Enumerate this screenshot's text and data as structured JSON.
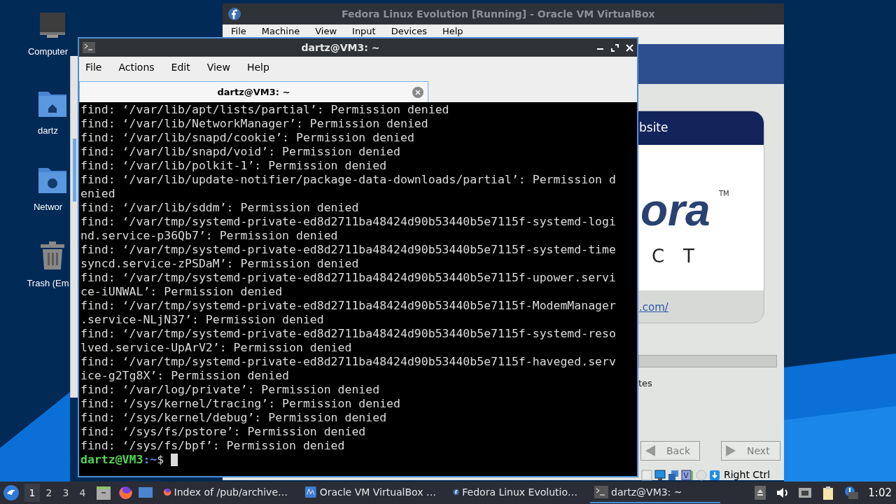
{
  "desktop_icons": [
    {
      "label": "Computer",
      "kind": "computer"
    },
    {
      "label": "dartz",
      "kind": "home"
    },
    {
      "label": "Networ",
      "kind": "network"
    },
    {
      "label": "Trash (Em",
      "kind": "trash"
    }
  ],
  "vbox_window": {
    "title": "Fedora Linux Evolution [Running] - Oracle VM VirtualBox",
    "menu": [
      "File",
      "Machine",
      "View",
      "Input",
      "Devices",
      "Help"
    ],
    "guest": {
      "card_heading": "bsite",
      "logo_text": "ora",
      "trademark": "TM",
      "logo_letters": [
        "C",
        "T"
      ],
      "link": ".com/",
      "progress": {
        "level": 1
      },
      "note": "tes",
      "buttons": [
        {
          "label": "Back",
          "kind": "back",
          "disabled": true
        },
        {
          "label": "Next",
          "kind": "next",
          "disabled": true
        }
      ]
    },
    "host_key": "Right Ctrl"
  },
  "terminal": {
    "title": "dartz@VM3: ~",
    "menu": [
      "File",
      "Actions",
      "Edit",
      "View",
      "Help"
    ],
    "tabs": [
      {
        "label": "dartz@VM3: ~",
        "selected": true
      }
    ],
    "lines": [
      "find: ‘/var/lib/apt/lists/partial’: Permission denied",
      "find: ‘/var/lib/NetworkManager’: Permission denied",
      "find: ‘/var/lib/snapd/cookie’: Permission denied",
      "find: ‘/var/lib/snapd/void’: Permission denied",
      "find: ‘/var/lib/polkit-1’: Permission denied",
      "find: ‘/var/lib/update-notifier/package-data-downloads/partial’: Permission denied",
      "find: ‘/var/lib/sddm’: Permission denied",
      "find: ‘/var/tmp/systemd-private-ed8d2711ba48424d90b53440b5e7115f-systemd-logind.service-p36Qb7’: Permission denied",
      "find: ‘/var/tmp/systemd-private-ed8d2711ba48424d90b53440b5e7115f-systemd-timesyncd.service-zPSDaM’: Permission denied",
      "find: ‘/var/tmp/systemd-private-ed8d2711ba48424d90b53440b5e7115f-upower.service-iUNWAL’: Permission denied",
      "find: ‘/var/tmp/systemd-private-ed8d2711ba48424d90b53440b5e7115f-ModemManager.service-NLjN37’: Permission denied",
      "find: ‘/var/tmp/systemd-private-ed8d2711ba48424d90b53440b5e7115f-systemd-resolved.service-UpArV2’: Permission denied",
      "find: ‘/var/tmp/systemd-private-ed8d2711ba48424d90b53440b5e7115f-haveged.service-g2Tg8X’: Permission denied",
      "find: ‘/var/log/private’: Permission denied",
      "find: ‘/sys/kernel/tracing’: Permission denied",
      "find: ‘/sys/kernel/debug’: Permission denied",
      "find: ‘/sys/fs/pstore’: Permission denied",
      "find: ‘/sys/fs/bpf’: Permission denied"
    ],
    "prompt": {
      "user_host": "dartz@VM3",
      "path": ":~",
      "symbol": "$"
    }
  },
  "taskbar": {
    "workspaces": [
      {
        "label": "1",
        "selected": true
      },
      {
        "label": "2",
        "selected": false
      },
      {
        "label": "3",
        "selected": false
      },
      {
        "label": "4",
        "selected": false
      }
    ],
    "tasks": [
      {
        "label": "Index of /pub/archive…",
        "kind": "browser",
        "selected": false
      },
      {
        "label": "Oracle VM VirtualBox …",
        "kind": "vbox",
        "selected": false
      },
      {
        "label": "Fedora Linux Evolutio…",
        "kind": "fedora",
        "selected": false
      },
      {
        "label": "dartz@VM3: ~",
        "kind": "terminal",
        "selected": true
      }
    ],
    "clock": "1:02"
  }
}
